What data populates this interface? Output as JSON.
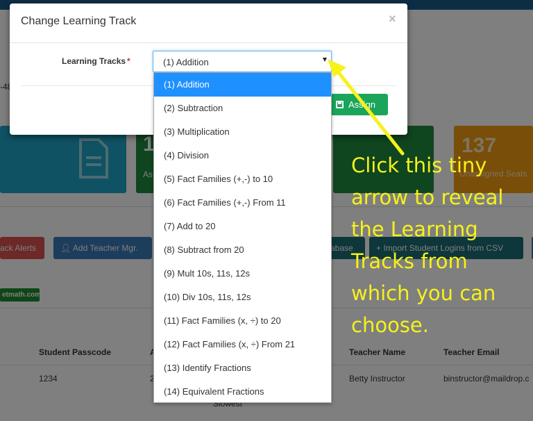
{
  "background": {
    "left_fragment": "-48",
    "tiles": [
      {
        "big": "",
        "small": ""
      },
      {
        "big": "1",
        "small": "As"
      },
      {
        "big": "",
        "small": ""
      },
      {
        "big": "137",
        "small": "Unassigned Seats"
      }
    ],
    "buttons": {
      "track_alerts": "ack Alerts",
      "add_teacher_mgr": "Add Teacher Mgr.",
      "database": "abase",
      "import_logins": "Import Student Logins from CSV"
    },
    "domain_badge": "etmath.com",
    "table": {
      "headers": [
        "Student Passcode",
        "A",
        "Teacher Name",
        "Teacher Email"
      ],
      "row": {
        "passcode": "1234",
        "a": "2",
        "teacher_name": "Betty Instructor",
        "teacher_email": "binstructor@maildrop.c",
        "note": "Slowest"
      }
    }
  },
  "modal": {
    "title": "Change Learning Track",
    "close": "×",
    "field_label": "Learning Tracks",
    "required_mark": "*",
    "selected_value": "(1) Addition",
    "assign_label": "Assign",
    "options": [
      "(1) Addition",
      "(2) Subtraction",
      "(3) Multiplication",
      "(4) Division",
      "(5) Fact Families (+,-) to 10",
      "(6) Fact Families (+,-) From 11",
      "(7) Add to 20",
      "(8) Subtract from 20",
      "(9) Mult 10s, 11s, 12s",
      "(10) Div 10s, 11s, 12s",
      "(11) Fact Families (x, ÷) to 20",
      "(12) Fact Families (x, ÷) From 21",
      "(13) Identify Fractions",
      "(14) Equivalent Fractions"
    ]
  },
  "annotation": {
    "lines": [
      "Click this tiny",
      "arrow to reveal",
      "the Learning",
      "Tracks from",
      "which you can",
      "choose."
    ],
    "color": "#f6f21a"
  },
  "colors": {
    "selected_option": "#1e90ff",
    "assign_button": "#1aa55a",
    "required": "#c9302c"
  }
}
